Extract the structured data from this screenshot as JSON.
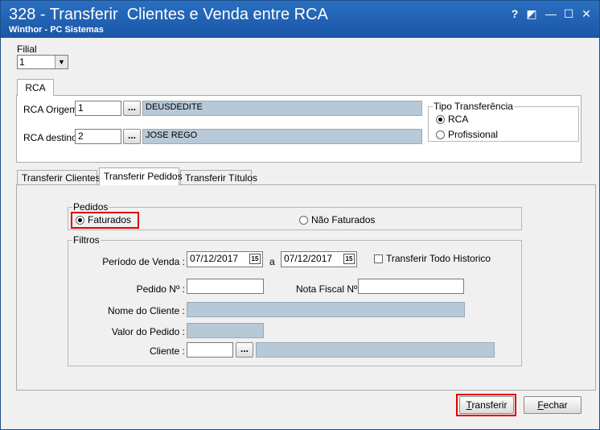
{
  "window": {
    "title": "328 - Transferir  Clientes e Venda entre RCA",
    "subtitle": "Winthor - PC Sistemas",
    "help_label": "?",
    "restore_label": "◩",
    "minimize_label": "—",
    "maximize_label": "☐",
    "close_label": "✕"
  },
  "filial": {
    "label": "Filial",
    "value": "1",
    "arrow": "▼"
  },
  "rca_tab": {
    "label": "RCA"
  },
  "rca": {
    "origem_label": "RCA Origem",
    "origem_code": "1",
    "origem_name": "DEUSDEDITE",
    "destino_label": "RCA destino",
    "destino_code": "2",
    "destino_name": "JOSE REGO",
    "browse_label": "..."
  },
  "tipo": {
    "legend": "Tipo Transferência",
    "options": [
      {
        "label": "RCA",
        "selected": true
      },
      {
        "label": "Profissional",
        "selected": false
      }
    ]
  },
  "tabs": [
    {
      "label": "Transferir Clientes",
      "active": false
    },
    {
      "label": "Transferir Pedidos",
      "active": true
    },
    {
      "label": "Transferir Títulos",
      "active": false
    }
  ],
  "pedidos": {
    "legend": "Pedidos",
    "faturados": "Faturados",
    "nao_faturados": "Não Faturados"
  },
  "filtros": {
    "legend": "Filtros",
    "periodo_label": "Período de Venda :",
    "date_from": "07/12/2017",
    "a_label": "a",
    "date_to": "07/12/2017",
    "cal_label": "15",
    "todo_historico_label": "Transferir Todo Historico",
    "pedido_label": "Pedido Nº :",
    "pedido_value": "",
    "nota_label": "Nota Fiscal Nº:",
    "nota_value": "",
    "nome_label": "Nome do Cliente :",
    "valor_label": "Valor do Pedido :",
    "cliente_label": "Cliente :",
    "cliente_code": "",
    "browse_label": "..."
  },
  "footer": {
    "transferir_first": "T",
    "transferir_rest": "ransferir",
    "fechar_first": "F",
    "fechar_rest": "echar"
  },
  "colors": {
    "highlight": "#e00000",
    "titlebar": "#1a56a8",
    "readonly": "#b7c8d7"
  }
}
